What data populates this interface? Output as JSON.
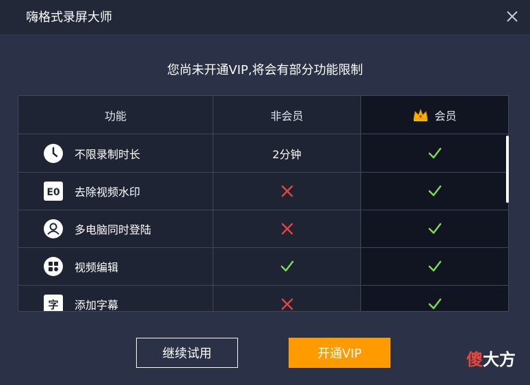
{
  "window": {
    "title": "嗨格式录屏大师"
  },
  "notice": "您尚未开通VIP,将会有部分功能限制",
  "table": {
    "headers": {
      "feature": "功能",
      "non_member": "非会员",
      "member": "会员"
    },
    "rows": [
      {
        "icon": "clock-icon",
        "feature": "不限录制时长",
        "non_member": "2分钟",
        "non_member_mark": "text",
        "member_mark": "check"
      },
      {
        "icon": "watermark-icon",
        "feature": "去除视频水印",
        "non_member": "",
        "non_member_mark": "cross",
        "member_mark": "check"
      },
      {
        "icon": "user-icon",
        "feature": "多电脑同时登陆",
        "non_member": "",
        "non_member_mark": "cross",
        "member_mark": "check"
      },
      {
        "icon": "grid-icon",
        "feature": "视频编辑",
        "non_member": "",
        "non_member_mark": "check",
        "member_mark": "check"
      },
      {
        "icon": "subtitle-icon",
        "feature": "添加字幕",
        "non_member": "",
        "non_member_mark": "cross",
        "member_mark": "check"
      }
    ]
  },
  "buttons": {
    "trial": "继续试用",
    "vip": "开通VIP"
  },
  "watermark": {
    "part1": "傻",
    "part2": "大方"
  },
  "colors": {
    "accent": "#ff9a00",
    "check": "#7ed957",
    "cross": "#e2453c",
    "crown": "#f5b400"
  }
}
